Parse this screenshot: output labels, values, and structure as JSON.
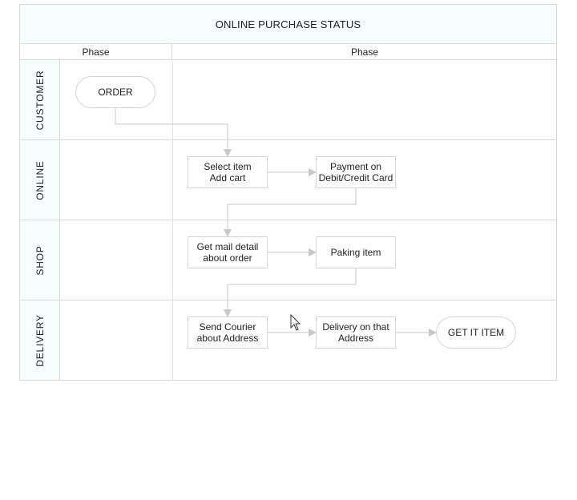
{
  "diagram": {
    "title": "ONLINE PURCHASE STATUS",
    "phases": [
      "Phase",
      "Phase"
    ],
    "lanes": [
      "CUSTOMER",
      "ONLINE",
      "SHOP",
      "DELIVERY"
    ],
    "nodes": {
      "order": "ORDER",
      "select_item": "Select item\nAdd cart",
      "payment": "Payment on\nDebit/Credit Card",
      "mail_detail": "Get mail detail\nabout order",
      "paking": "Paking item",
      "send_courier": "Send Courier\nabout Address",
      "delivery_address": "Delivery on that\nAddress",
      "get_item": "GET IT ITEM"
    },
    "connectors": [
      [
        "order",
        "select_item"
      ],
      [
        "select_item",
        "payment"
      ],
      [
        "payment",
        "mail_detail"
      ],
      [
        "mail_detail",
        "paking"
      ],
      [
        "paking",
        "send_courier"
      ],
      [
        "send_courier",
        "delivery_address"
      ],
      [
        "delivery_address",
        "get_item"
      ]
    ],
    "colors": {
      "lane_header_fill": "#f5fdfd",
      "border": "#d9d9d9",
      "connector": "#c8c8c8"
    }
  }
}
